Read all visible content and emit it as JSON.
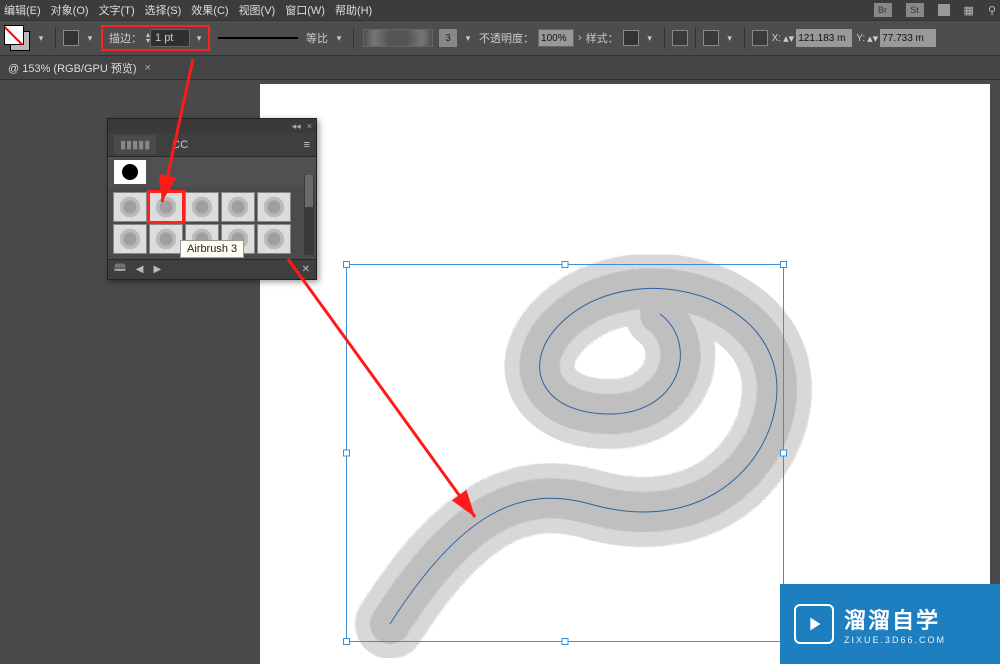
{
  "menu": {
    "items": [
      "编辑(E)",
      "对象(O)",
      "文字(T)",
      "选择(S)",
      "效果(C)",
      "视图(V)",
      "窗口(W)",
      "帮助(H)"
    ],
    "right_badges": [
      "Br",
      "St"
    ]
  },
  "options": {
    "stroke_label": "描边：",
    "stroke_value": "1 pt",
    "dash_label": "等比",
    "brush_num": "3",
    "opacity_label": "不透明度：",
    "opacity_value": "100%",
    "style_label": "样式：",
    "x_label": "X:",
    "x_value": "121.183 m",
    "y_label": "Y:",
    "y_value": "77.733 m"
  },
  "document": {
    "tab_title": "@ 153% (RGB/GPU 预览)"
  },
  "panel": {
    "title": "CC",
    "tooltip": "Airbrush 3",
    "thumbs": [
      "spray1",
      "spray2",
      "spray3",
      "spray4",
      "spray5",
      "spray6",
      "spray7",
      "spray8",
      "spray9",
      "spray10"
    ],
    "selected_index": 1
  },
  "watermark": {
    "title": "溜溜自学",
    "url": "ZIXUE.3D66.COM"
  }
}
